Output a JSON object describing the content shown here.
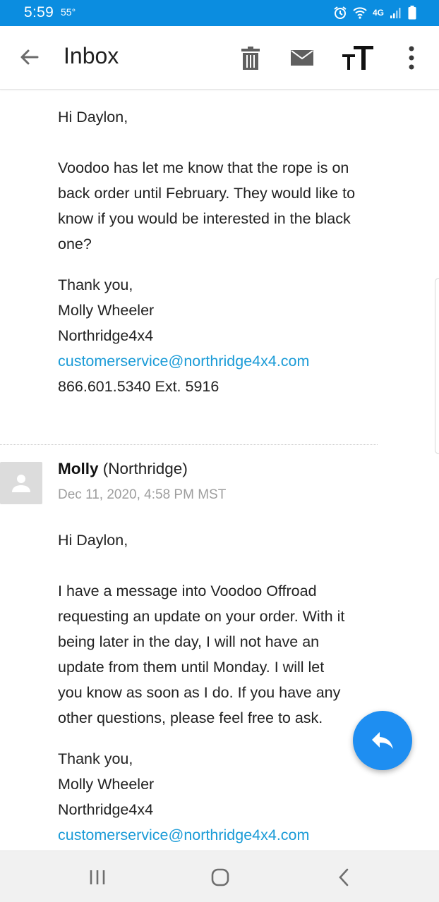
{
  "status_bar": {
    "time": "5:59",
    "temperature": "55°",
    "network": "4G"
  },
  "app_bar": {
    "title": "Inbox"
  },
  "message_1": {
    "greeting": "Hi Daylon,",
    "body_lines": [
      "Voodoo has let me know that the rope is on",
      "back order until February. They would like to",
      "know if you would be interested in the black",
      "one?"
    ],
    "signoff": "Thank you,",
    "signer_name": "Molly Wheeler",
    "company": "Northridge4x4",
    "email": "customerservice@northridge4x4.com",
    "phone": "866.601.5340 Ext. 5916"
  },
  "message_2": {
    "sender_name": "Molly",
    "sender_org": "(Northridge)",
    "date": "Dec 11, 2020, 4:58 PM MST",
    "greeting": "Hi Daylon,",
    "body_lines": [
      "I have a message into Voodoo Offroad",
      "requesting an update on your order. With it",
      "being later in the day, I will not have an",
      "update from them until Monday. I will let",
      "you know as soon as I do. If you have any",
      "other questions, please feel free to ask."
    ],
    "signoff": "Thank you,",
    "signer_name": "Molly Wheeler",
    "company": "Northridge4x4",
    "email": "customerservice@northridge4x4.com"
  },
  "icons": {
    "back": "arrow-back-icon",
    "delete": "trash-icon",
    "mark_unread": "mail-icon",
    "text_size": "text-size-icon",
    "more": "more-vert-icon",
    "reply": "reply-icon"
  },
  "colors": {
    "status_bar": "#0b8de0",
    "link": "#1a9bd7",
    "fab": "#1e8ef1"
  }
}
